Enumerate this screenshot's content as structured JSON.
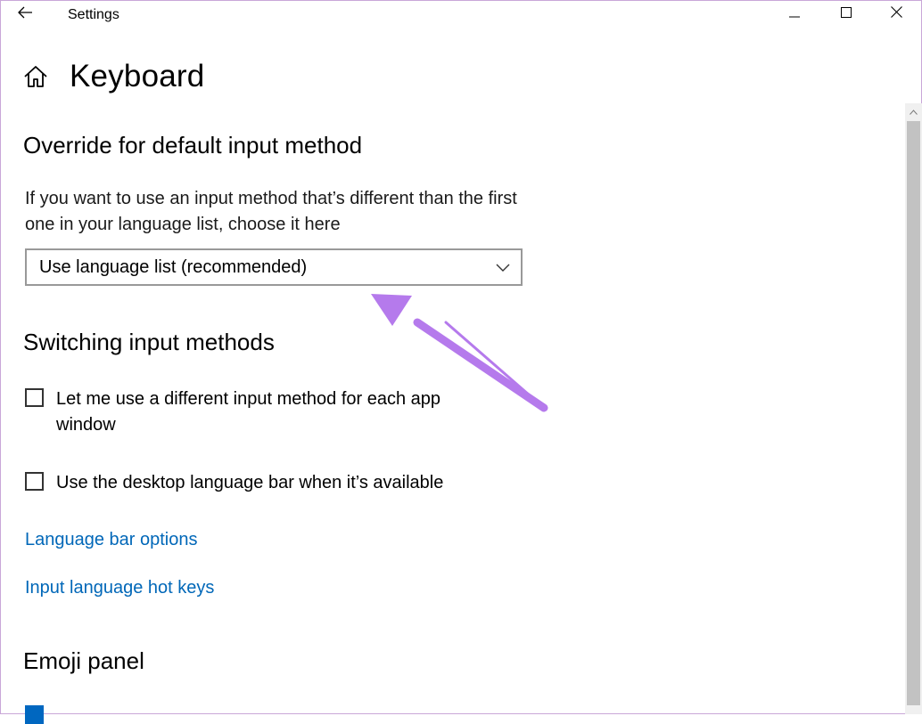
{
  "titlebar": {
    "app_title": "Settings"
  },
  "page": {
    "title": "Keyboard"
  },
  "override_section": {
    "heading": "Override for default input method",
    "description": "If you want to use an input method that’s different than the first one in your language list, choose it here",
    "dropdown_value": "Use language list (recommended)"
  },
  "switching_section": {
    "heading": "Switching input methods",
    "checkbox_per_app": "Let me use a different input method for each app window",
    "checkbox_per_app_checked": false,
    "checkbox_language_bar": "Use the desktop language bar when it’s available",
    "checkbox_language_bar_checked": false,
    "link_language_bar_options": "Language bar options",
    "link_hot_keys": "Input language hot keys"
  },
  "emoji_section": {
    "heading": "Emoji panel",
    "checkbox_checked": true
  },
  "colors": {
    "accent": "#0067c0",
    "link": "#0067b8",
    "annotation_arrow": "#b57aec"
  }
}
